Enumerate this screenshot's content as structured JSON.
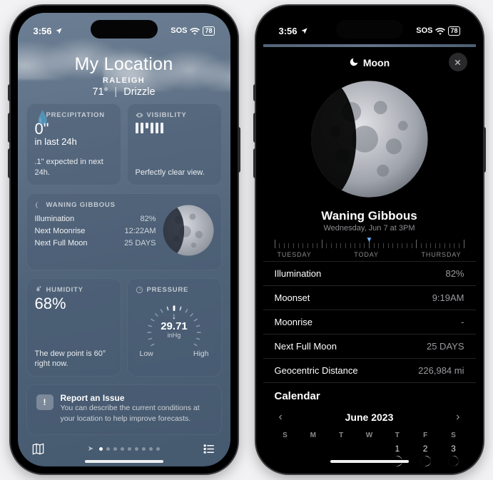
{
  "statusbar": {
    "time": "3:56",
    "sos": "SOS",
    "battery": "78"
  },
  "weather": {
    "location_title": "My Location",
    "city": "RALEIGH",
    "temp": "71°",
    "condition": "Drizzle",
    "cards": {
      "precipitation": {
        "header": "PRECIPITATION",
        "big": "0\"",
        "subline": "in last 24h",
        "footer": ".1\" expected in next 24h."
      },
      "visibility": {
        "header": "VISIBILITY",
        "footer": "Perfectly clear view."
      },
      "moon": {
        "header": "WANING GIBBOUS",
        "rows": [
          {
            "label": "Illumination",
            "value": "82%"
          },
          {
            "label": "Next Moonrise",
            "value": "12:22AM"
          },
          {
            "label": "Next Full Moon",
            "value": "25 DAYS"
          }
        ]
      },
      "humidity": {
        "header": "HUMIDITY",
        "big": "68%",
        "footer": "The dew point is 60° right now."
      },
      "pressure": {
        "header": "PRESSURE",
        "value": "29.71",
        "unit": "inHg",
        "low": "Low",
        "high": "High"
      }
    },
    "report": {
      "title": "Report an Issue",
      "sub": "You can describe the current conditions at your location to help improve forecasts."
    }
  },
  "moon_detail": {
    "title": "Moon",
    "phase": "Waning Gibbous",
    "date_line": "Wednesday, Jun 7 at 3PM",
    "scrubber_labels": {
      "left": "TUESDAY",
      "center": "TODAY",
      "right": "THURSDAY"
    },
    "stats": [
      {
        "label": "Illumination",
        "value": "82%"
      },
      {
        "label": "Moonset",
        "value": "9:19AM"
      },
      {
        "label": "Moonrise",
        "value": "-"
      },
      {
        "label": "Next Full Moon",
        "value": "25 DAYS"
      },
      {
        "label": "Geocentric Distance",
        "value": "226,984 mi"
      }
    ],
    "calendar": {
      "heading": "Calendar",
      "month": "June 2023",
      "dow": [
        "S",
        "M",
        "T",
        "W",
        "T",
        "F",
        "S"
      ],
      "days_visible": [
        "1",
        "2",
        "3"
      ]
    }
  }
}
